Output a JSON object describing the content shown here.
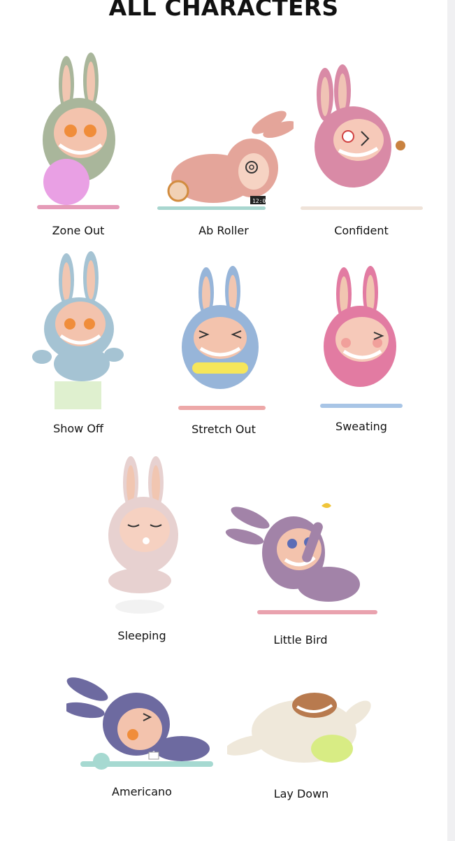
{
  "page": {
    "title": "ALL CHARACTERS"
  },
  "characters": [
    {
      "name": "Zone Out",
      "fur": "#a9b69b",
      "mat": "#e59bb8",
      "prop": "ball"
    },
    {
      "name": "Ab Roller",
      "fur": "#e4a59a",
      "mat": "#a8d6cf",
      "prop": "clock"
    },
    {
      "name": "Confident",
      "fur": "#d98aa6",
      "mat": "#efe3d9",
      "prop": "cookie"
    },
    {
      "name": "Show Off",
      "fur": "#a5c3d3",
      "mat": "#dff0cf",
      "prop": "block"
    },
    {
      "name": "Stretch Out",
      "fur": "#97b5d9",
      "mat": "#eda8a8",
      "prop": "band"
    },
    {
      "name": "Sweating",
      "fur": "#e27ba2",
      "mat": "#a8c5e6",
      "prop": "none"
    },
    {
      "name": "Sleeping",
      "fur": "#e7d1d0",
      "mat": "#ffffff",
      "prop": "none"
    },
    {
      "name": "Little Bird",
      "fur": "#a283a8",
      "mat": "#e9a2ae",
      "prop": "bird"
    },
    {
      "name": "Americano",
      "fur": "#6d6aa0",
      "mat": "#a6d9d1",
      "prop": "cup"
    },
    {
      "name": "Lay Down",
      "fur": "#efe8da",
      "mat": "#d8ec84",
      "prop": "pillow"
    }
  ]
}
